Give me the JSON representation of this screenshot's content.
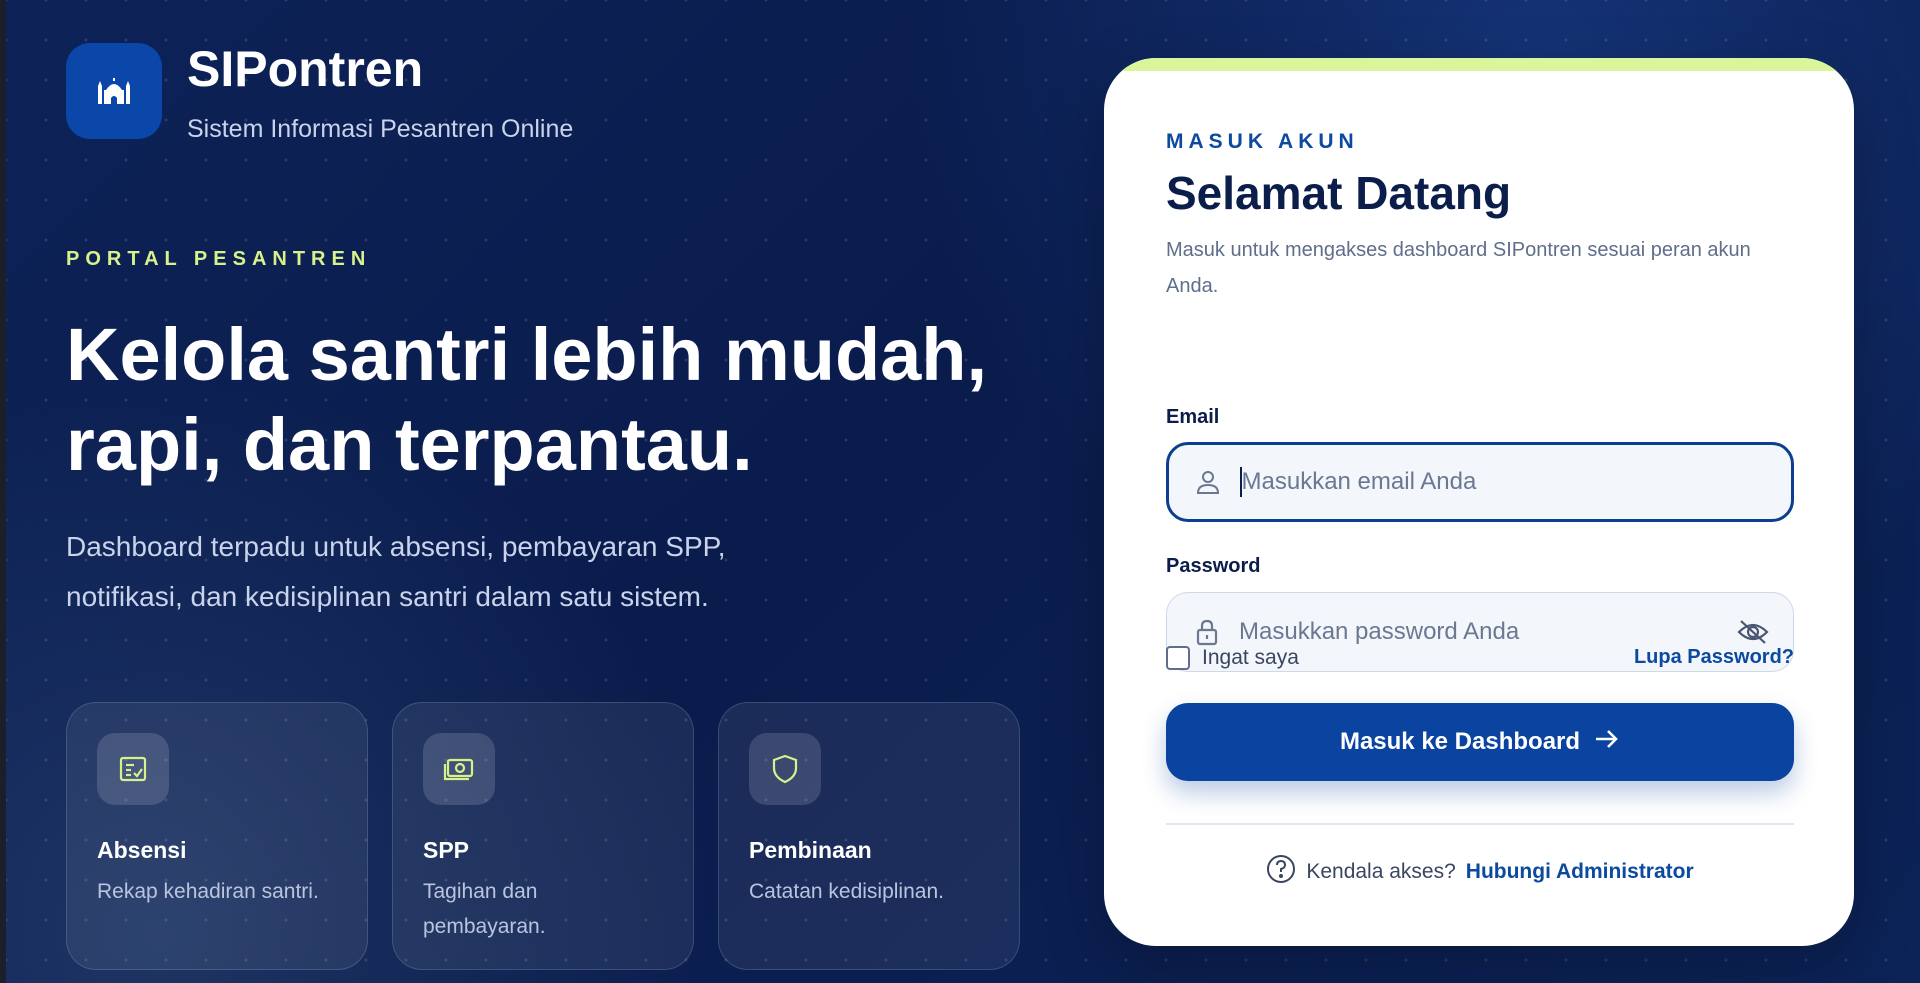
{
  "brand": {
    "name": "SIPontren",
    "subtitle": "Sistem Informasi Pesantren Online",
    "logo_icon": "mosque-icon"
  },
  "hero": {
    "eyebrow": "PORTAL PESANTREN",
    "headline_line1": "Kelola santri lebih mudah,",
    "headline_line2": "rapi, dan terpantau.",
    "lead_line1": "Dashboard terpadu untuk absensi, pembayaran SPP,",
    "lead_line2": "notifikasi, dan kedisiplinan santri dalam satu sistem."
  },
  "features": [
    {
      "title": "Absensi",
      "desc": "Rekap kehadiran santri.",
      "icon": "attendance-icon"
    },
    {
      "title": "SPP",
      "desc": "Tagihan dan pembayaran.",
      "icon": "money-icon"
    },
    {
      "title": "Pembinaan",
      "desc": "Catatan kedisiplinan.",
      "icon": "shield-icon"
    }
  ],
  "login": {
    "eyebrow": "MASUK AKUN",
    "title": "Selamat Datang",
    "description": "Masuk untuk mengakses dashboard SIPontren sesuai peran akun Anda.",
    "email_label": "Email",
    "email_placeholder": "Masukkan email Anda",
    "password_label": "Password",
    "password_placeholder": "Masukkan password Anda",
    "remember_label": "Ingat saya",
    "forgot_label": "Lupa Password?",
    "submit_label": "Masuk ke Dashboard",
    "help_text": "Kendala akses?",
    "help_link": "Hubungi Administrator"
  },
  "colors": {
    "background": "#0b1e4e",
    "accent_lime": "#d7f28b",
    "primary_blue": "#0a43a0",
    "text_dark": "#0b1d4a"
  }
}
